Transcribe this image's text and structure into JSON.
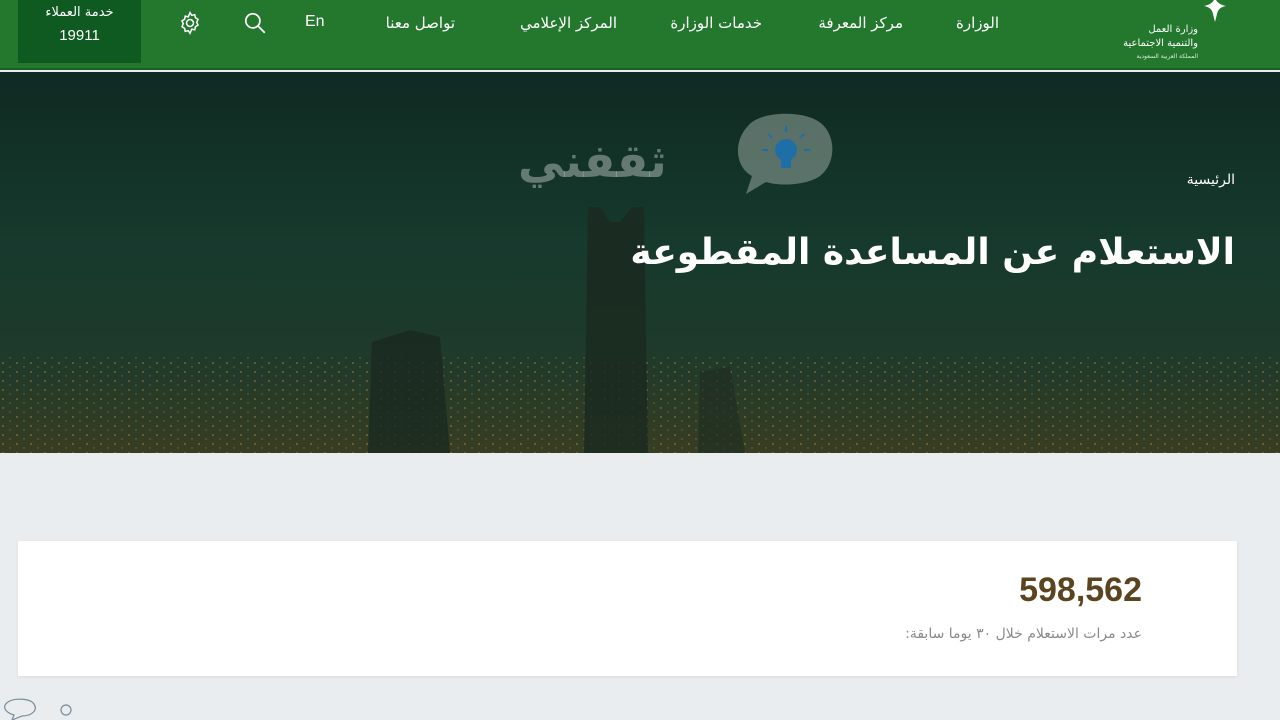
{
  "header": {
    "customer_service": {
      "title": "خدمة العملاء",
      "number": "19911"
    },
    "language_toggle": "En",
    "nav": {
      "contact": "تواصل معنا",
      "media_center": "المركز الإعلامي",
      "services": "خدمات الوزارة",
      "knowledge_center": "مركز المعرفة",
      "ministry": "الوزارة"
    },
    "logo": {
      "line1": "وزارة العمل",
      "line2": "والتنمية الاجتماعية",
      "line3": "المملكة العربية السعودية",
      "icon": "palm-emblem-icon"
    },
    "icons": {
      "settings": "gear-icon",
      "search": "search-icon"
    }
  },
  "hero": {
    "watermark": {
      "text": "ثقفني",
      "icon": "lightbulb-bubble-icon"
    },
    "breadcrumb": "الرئيسية",
    "title": "الاستعلام عن المساعدة المقطوعة"
  },
  "stats": {
    "value": "598,562",
    "label": "عدد مرات الاستعلام خلال ٣٠ يوما سابقة:"
  },
  "colors": {
    "nav_green": "#23782e",
    "cs_dark_green": "#0f5a20",
    "stat_brown": "#5a4520",
    "page_bg": "#e9edef"
  }
}
